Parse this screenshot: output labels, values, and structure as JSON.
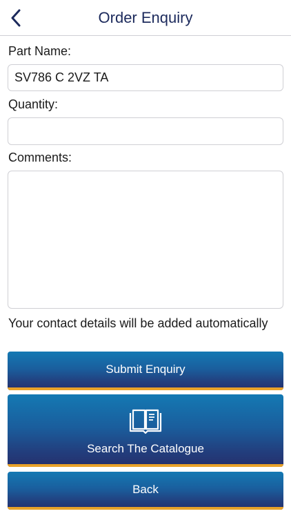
{
  "nav": {
    "title": "Order Enquiry",
    "back_icon": "chevron-left-icon"
  },
  "form": {
    "part_name": {
      "label": "Part Name:",
      "value": "SV786 C 2VZ TA"
    },
    "quantity": {
      "label": "Quantity:",
      "value": ""
    },
    "comments": {
      "label": "Comments:",
      "value": ""
    }
  },
  "note": "Your contact details will be added automatically",
  "buttons": {
    "submit": "Submit Enquiry",
    "catalogue": "Search The Catalogue",
    "catalogue_icon": "open-book-icon",
    "back": "Back"
  },
  "colors": {
    "nav_title": "#1c2a5c",
    "button_top": "#1479b3",
    "button_bottom": "#252f6c",
    "button_accent": "#e9a229"
  }
}
